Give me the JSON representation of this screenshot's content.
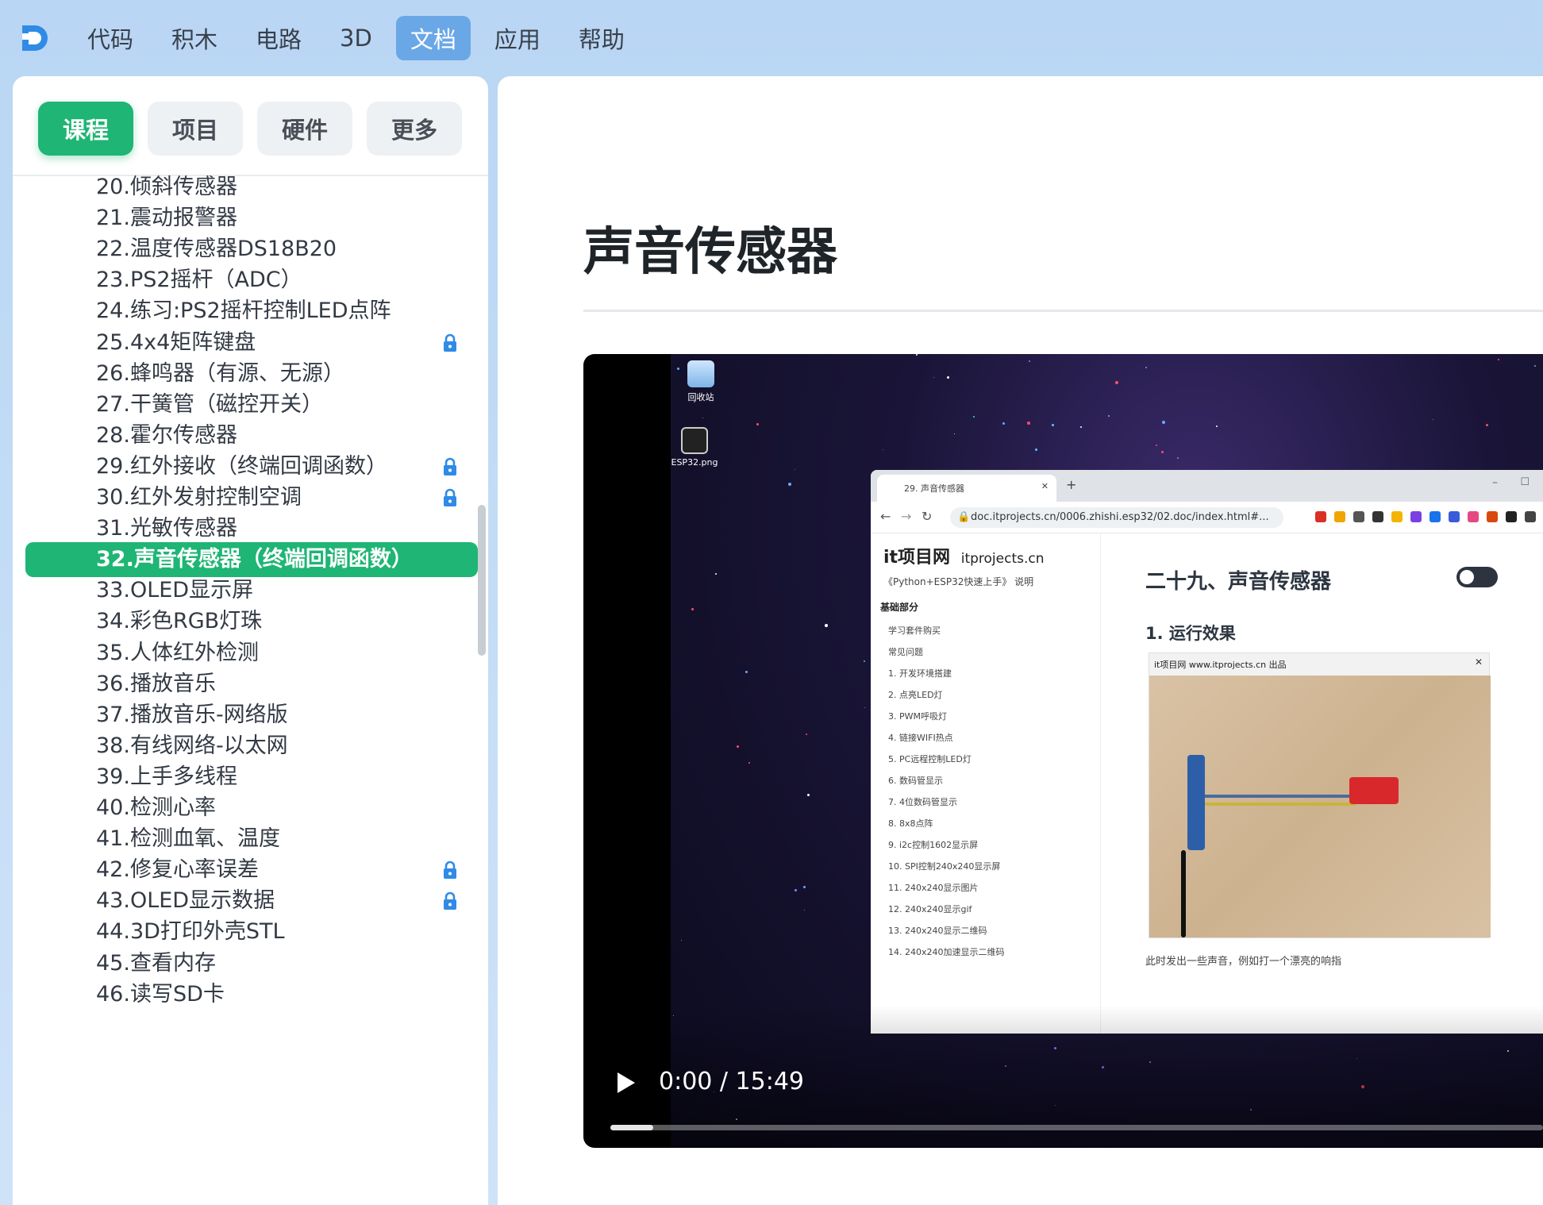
{
  "nav": {
    "items": [
      "代码",
      "积木",
      "电路",
      "3D",
      "文档",
      "应用",
      "帮助"
    ],
    "active_index": 4
  },
  "sidebar": {
    "tabs": [
      "课程",
      "项目",
      "硬件",
      "更多"
    ],
    "active_tab": 0,
    "items": [
      {
        "label": "20.倾斜传感器",
        "locked": false
      },
      {
        "label": "21.震动报警器",
        "locked": false
      },
      {
        "label": "22.温度传感器DS18B20",
        "locked": false
      },
      {
        "label": "23.PS2摇杆（ADC）",
        "locked": false
      },
      {
        "label": "24.练习:PS2摇杆控制LED点阵",
        "locked": false
      },
      {
        "label": "25.4x4矩阵键盘",
        "locked": true
      },
      {
        "label": "26.蜂鸣器（有源、无源）",
        "locked": false
      },
      {
        "label": "27.干簧管（磁控开关）",
        "locked": false
      },
      {
        "label": "28.霍尔传感器",
        "locked": false
      },
      {
        "label": "29.红外接收（终端回调函数）",
        "locked": true
      },
      {
        "label": "30.红外发射控制空调",
        "locked": true
      },
      {
        "label": "31.光敏传感器",
        "locked": false
      },
      {
        "label": "32.声音传感器（终端回调函数）",
        "locked": false,
        "active": true
      },
      {
        "label": "33.OLED显示屏",
        "locked": false
      },
      {
        "label": "34.彩色RGB灯珠",
        "locked": false
      },
      {
        "label": "35.人体红外检测",
        "locked": false
      },
      {
        "label": "36.播放音乐",
        "locked": false
      },
      {
        "label": "37.播放音乐-网络版",
        "locked": false
      },
      {
        "label": "38.有线网络-以太网",
        "locked": false
      },
      {
        "label": "39.上手多线程",
        "locked": false
      },
      {
        "label": "40.检测心率",
        "locked": false
      },
      {
        "label": "41.检测血氧、温度",
        "locked": false
      },
      {
        "label": "42.修复心率误差",
        "locked": true
      },
      {
        "label": "43.OLED显示数据",
        "locked": true
      },
      {
        "label": "44.3D打印外壳STL",
        "locked": false
      },
      {
        "label": "45.查看内存",
        "locked": false
      },
      {
        "label": "46.读写SD卡",
        "locked": false
      }
    ]
  },
  "content": {
    "title": "声音传感器"
  },
  "video": {
    "time": "0:00 / 15:49",
    "progress": 0.046,
    "desktop_icons": [
      "回收站",
      "ESP32.png"
    ],
    "browser": {
      "tab_title": "29. 声音传感器",
      "url": "doc.itprojects.cn/0006.zhishi.esp32/02.doc/index.html#...",
      "site_name": "it项目网",
      "site_domain": "itprojects.cn",
      "subtitle": "《Python+ESP32快速上手》 说明",
      "section": "基础部分",
      "menu": [
        "学习套件购买",
        "常见问题",
        "1. 开发环境搭建",
        "2. 点亮LED灯",
        "3. PWM呼吸灯",
        "4. 链接WIFI热点",
        "5. PC远程控制LED灯",
        "6. 数码管显示",
        "7. 4位数码管显示",
        "8. 8x8点阵",
        "9. i2c控制1602显示屏",
        "10. SPI控制240x240显示屏",
        "11. 240x240显示图片",
        "12. 240x240显示gif",
        "13. 240x240显示二维码",
        "14. 240x240加速显示二维码"
      ],
      "heading": "二十九、声音传感器",
      "subheading": "1. 运行效果",
      "video_caption": "it项目网 www.itprojects.cn 出品",
      "body_text": "此时发出一些声音，例如打一个漂亮的响指"
    }
  },
  "colors": {
    "accent": "#1fb574",
    "nav_active": "#6aa7e6",
    "lock": "#2f8be6"
  }
}
